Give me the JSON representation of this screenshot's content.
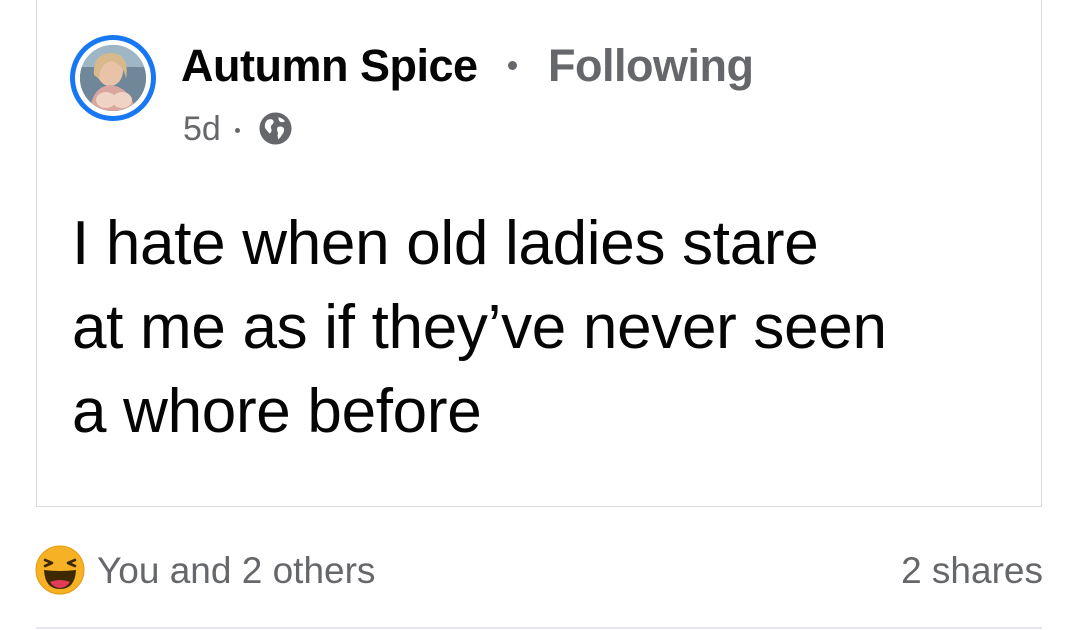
{
  "post": {
    "author_name": "Autumn Spice",
    "follow_status": "Following",
    "timestamp": "5d",
    "privacy_icon": "globe-icon",
    "text_lines": [
      "I hate when old ladies stare",
      "at me as if they’ve never seen",
      "a whore before"
    ]
  },
  "engagement": {
    "reaction_icon": "haha-emoji-icon",
    "reactions_label": "You and 2 others",
    "shares_label": "2 shares"
  },
  "colors": {
    "story_ring": "#1877f2",
    "primary_text": "#050505",
    "secondary_text": "#65676b",
    "reaction_yellow": "#f7b125"
  }
}
